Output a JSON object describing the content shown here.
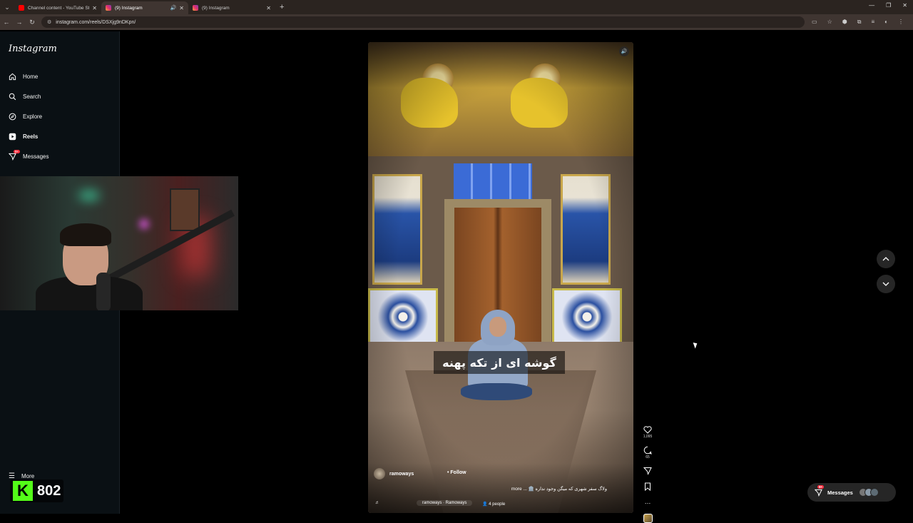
{
  "browser": {
    "tabs": [
      {
        "title": "Channel content - YouTube Stu",
        "favicon": "youtube",
        "active": false
      },
      {
        "title": "(9) Instagram",
        "favicon": "instagram",
        "active": true
      },
      {
        "title": "(9) Instagram",
        "favicon": "instagram",
        "active": false
      }
    ],
    "url": "instagram.com/reels/DSXjg9nDKpn/"
  },
  "sidebar": {
    "logo": "Instagram",
    "items": [
      {
        "label": "Home",
        "icon": "home-icon"
      },
      {
        "label": "Search",
        "icon": "search-icon"
      },
      {
        "label": "Explore",
        "icon": "compass-icon"
      },
      {
        "label": "Reels",
        "icon": "reels-icon",
        "active": true
      },
      {
        "label": "Messages",
        "icon": "messenger-icon",
        "badge": "9+"
      }
    ],
    "more_label": "More"
  },
  "overlay": {
    "kick_logo": "K",
    "viewer_count": "802"
  },
  "reel": {
    "subtitle": "گوشه ای از تکه پهنه",
    "author": "ramoways",
    "follow_label": "Follow",
    "caption": "ولاگ سفر شهری که میگن وجود نداره 🏛️ ... more",
    "audio": "ramoways · Ramoways",
    "people": "4 people",
    "likes": "1,095",
    "comments": "65"
  },
  "messages_pill": {
    "label": "Messages",
    "badge": "9+"
  },
  "colors": {
    "accent_badge": "#ff3040",
    "kick_green": "#53fc18",
    "page_bg": "#000000"
  }
}
